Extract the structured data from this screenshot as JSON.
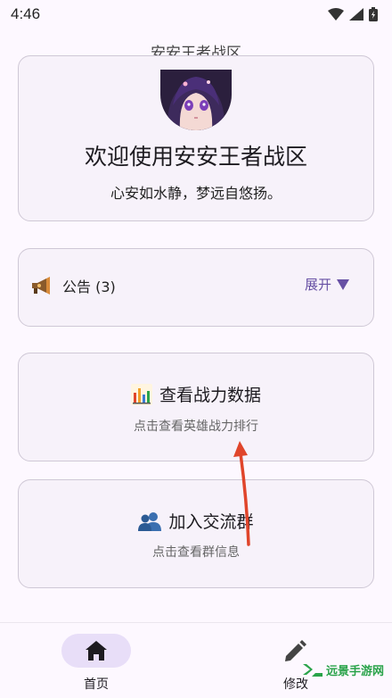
{
  "status_bar": {
    "time": "4:46"
  },
  "app_bar": {
    "title": "安安王者战区"
  },
  "hero": {
    "title": "欢迎使用安安王者战区",
    "subtitle": "心安如水静，梦远自悠扬。"
  },
  "notice": {
    "label": "公告 (3)",
    "expand_label": "展开"
  },
  "power_card": {
    "title": "查看战力数据",
    "subtitle": "点击查看英雄战力排行"
  },
  "group_card": {
    "title": "加入交流群",
    "subtitle": "点击查看群信息"
  },
  "bottom_nav": {
    "home_label": "首页",
    "edit_label": "修改"
  },
  "watermark": {
    "text": "远景手游网"
  },
  "colors": {
    "accent": "#6750a4",
    "arrow": "#e0452b",
    "card_bg": "#f7f2fa",
    "nav_active": "#e8def8"
  }
}
